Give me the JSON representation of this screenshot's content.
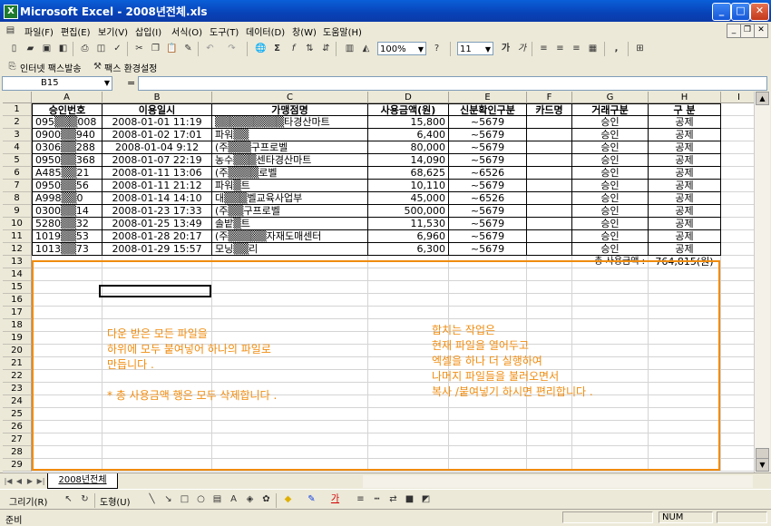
{
  "window": {
    "title": "Microsoft Excel - 2008년전체.xls"
  },
  "menu": [
    "파일(F)",
    "편집(E)",
    "보기(V)",
    "삽입(I)",
    "서식(O)",
    "도구(T)",
    "데이터(D)",
    "창(W)",
    "도움말(H)"
  ],
  "toolbar": {
    "zoom": "100%",
    "font_size": "11",
    "bold_label": "가",
    "italic_label": "가"
  },
  "toolbar2": {
    "fax_send": "인터넷 팩스발송",
    "fax_settings": "팩스 환경설정"
  },
  "formula": {
    "name_box": "B15",
    "fx": "="
  },
  "columns": [
    "A",
    "B",
    "C",
    "D",
    "E",
    "F",
    "G",
    "H",
    "I"
  ],
  "rows": [
    "1",
    "2",
    "3",
    "4",
    "5",
    "6",
    "7",
    "8",
    "9",
    "10",
    "11",
    "12",
    "13",
    "14",
    "15",
    "16",
    "17",
    "18",
    "19",
    "20",
    "21",
    "22",
    "23",
    "24",
    "25",
    "26",
    "27",
    "28",
    "29"
  ],
  "table": {
    "headers": [
      "승인번호",
      "이용일시",
      "가맹점명",
      "사용금액(원)",
      "신분확인구분",
      "카드명",
      "거래구분",
      "구 분"
    ],
    "rows": [
      [
        "095▒▒▒008",
        "2008-01-01 11:19",
        "▒▒▒▒▒▒▒▒▒타경산마트",
        "15,800",
        "~5679",
        "",
        "승인",
        "공제"
      ],
      [
        "0900▒▒940",
        "2008-01-02 17:01",
        "파워▒▒",
        "6,400",
        "~5679",
        "",
        "승인",
        "공제"
      ],
      [
        "0306▒▒288",
        "2008-01-04 9:12",
        "(주▒▒▒구프로벨",
        "80,000",
        "~5679",
        "",
        "승인",
        "공제"
      ],
      [
        "0950▒▒368",
        "2008-01-07 22:19",
        "농수▒▒▒센타경산마트",
        "14,090",
        "~5679",
        "",
        "승인",
        "공제"
      ],
      [
        "A485▒▒21",
        "2008-01-11 13:06",
        "(주▒▒▒▒로벨",
        "68,625",
        "~6526",
        "",
        "승인",
        "공제"
      ],
      [
        "0950▒▒56",
        "2008-01-11 21:12",
        "파워▒트",
        "10,110",
        "~5679",
        "",
        "승인",
        "공제"
      ],
      [
        "A998▒▒0",
        "2008-01-14 14:10",
        "대▒▒▒벨교육사업부",
        "45,000",
        "~6526",
        "",
        "승인",
        "공제"
      ],
      [
        "0300▒▒14",
        "2008-01-23 17:33",
        "(주▒▒구프로벨",
        "500,000",
        "~5679",
        "",
        "승인",
        "공제"
      ],
      [
        "5280▒▒32",
        "2008-01-25 13:49",
        "솔밭▒트",
        "11,530",
        "~5679",
        "",
        "승인",
        "공제"
      ],
      [
        "1019▒▒53",
        "2008-01-28 20:17",
        "(주▒▒▒▒▒자재도매센터",
        "6,960",
        "~5679",
        "",
        "승인",
        "공제"
      ],
      [
        "1013▒▒73",
        "2008-01-29 15:57",
        "모닝▒▒리",
        "6,300",
        "~5679",
        "",
        "승인",
        "공제"
      ]
    ],
    "total_label": "총 사용금액 :",
    "total_value": "764,815(원)"
  },
  "notes": {
    "left": [
      "다운 받은 모든 파일을",
      "하위에 모두 붙여넣어 하나의 파일로",
      "만듭니다 .",
      "",
      "* 총 사용금액 행은 모두 삭제합니다 ."
    ],
    "right": [
      "합치는 작업은",
      "현재 파일을 열어두고",
      "엑셀을 하나 더 실행하여",
      "나머지 파일들을 불러오면서",
      "복사 /붙여넣기 하시면 편리합니다 ."
    ]
  },
  "sheet_tab": "2008년전체",
  "draw_toolbar": {
    "draw_label": "그리기(R)",
    "autoshape_label": "도형(U)",
    "font_color_label": "가"
  },
  "status": {
    "ready": "준비",
    "num": "NUM"
  },
  "colors": {
    "accent": "#f08c0f",
    "titlebar": "#0842b8"
  }
}
